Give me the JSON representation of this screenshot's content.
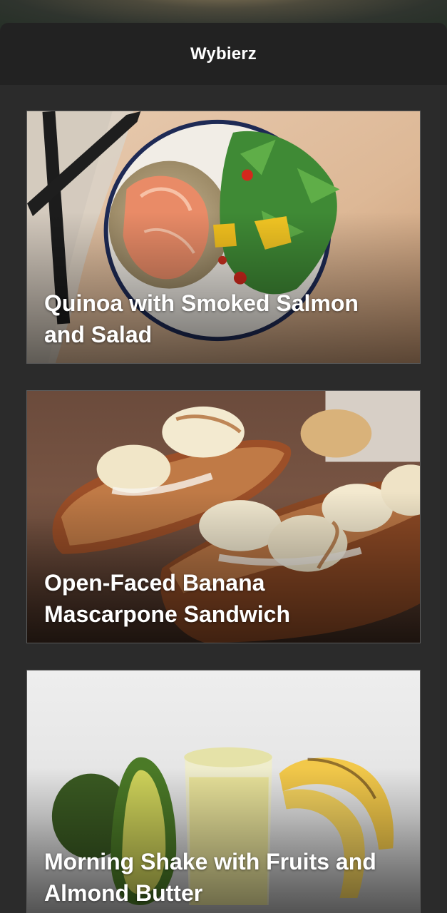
{
  "header": {
    "title": "Wybierz"
  },
  "recipes": [
    {
      "title": "Quinoa with Smoked Salmon and Salad",
      "image_icon": "salmon-quinoa-salad-photo"
    },
    {
      "title": "Open-Faced Banana Mascarpone Sandwich",
      "image_icon": "banana-toast-photo"
    },
    {
      "title": "Morning Shake with Fruits and Almond Butter",
      "image_icon": "fruit-shake-photo"
    }
  ]
}
